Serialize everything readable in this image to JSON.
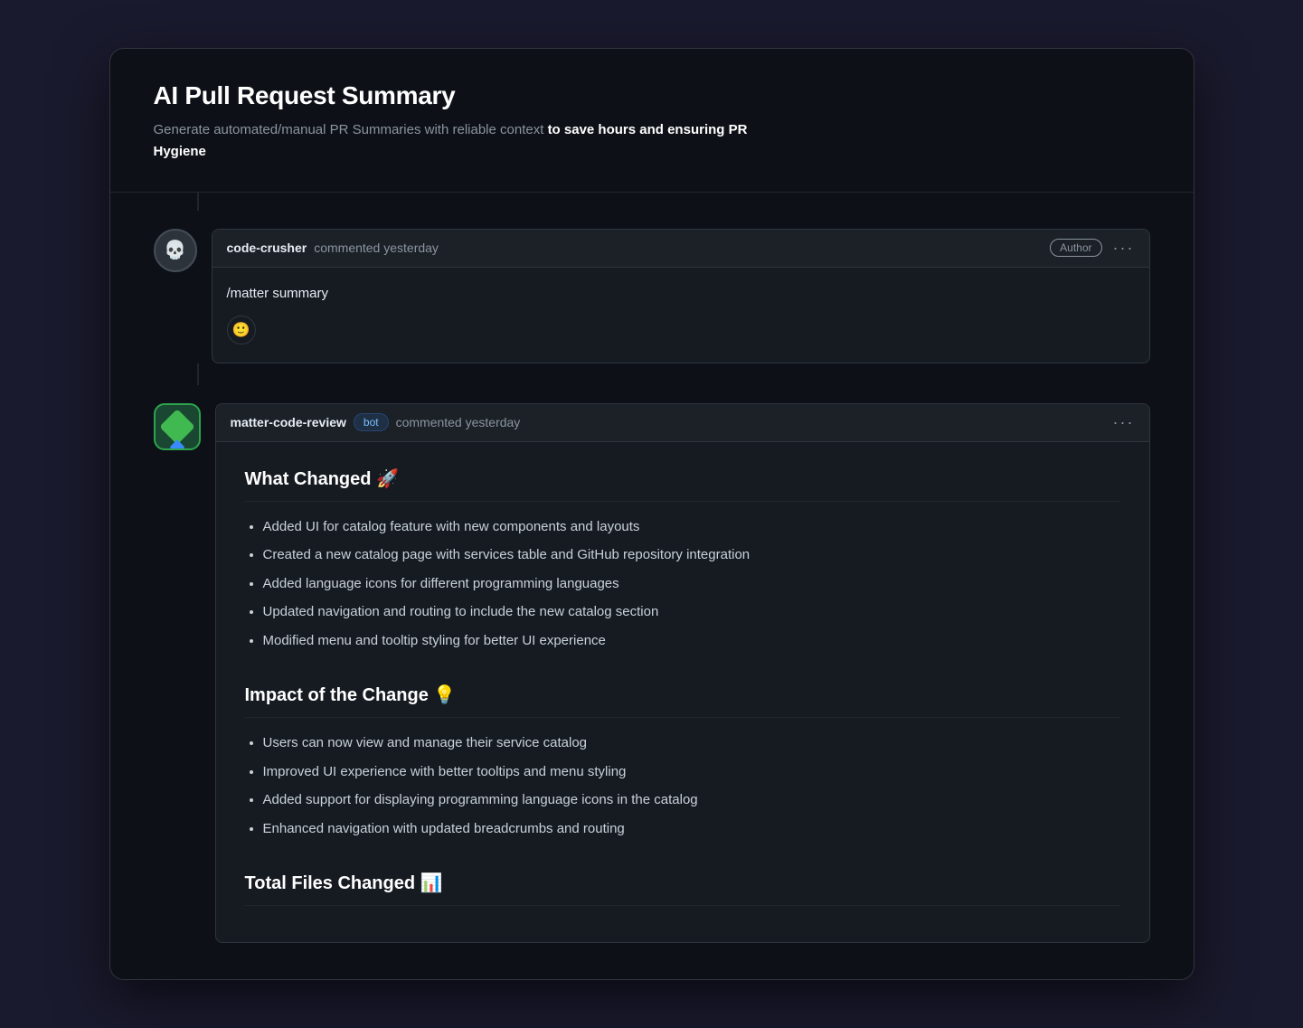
{
  "app": {
    "title": "AI Pull Request Summary",
    "subtitle_start": "Generate automated/manual PR Summaries with reliable context ",
    "subtitle_bold": "to save hours and ensuring PR Hygiene"
  },
  "comments": [
    {
      "id": "comment-1",
      "avatar_type": "human",
      "avatar_emoji": "💀",
      "author": "code-crusher",
      "time_text": "commented yesterday",
      "badges": [
        "Author"
      ],
      "has_dots": true,
      "body_text": "/matter summary",
      "has_emoji_reaction": true
    },
    {
      "id": "comment-2",
      "avatar_type": "bot",
      "author": "matter-code-review",
      "bot_badge": "bot",
      "time_text": "commented yesterday",
      "has_dots": true,
      "sections": [
        {
          "title": "What Changed 🚀",
          "items": [
            "Added UI for catalog feature with new components and layouts",
            "Created a new catalog page with services table and GitHub repository integration",
            "Added language icons for different programming languages",
            "Updated navigation and routing to include the new catalog section",
            "Modified menu and tooltip styling for better UI experience"
          ]
        },
        {
          "title": "Impact of the Change 💡",
          "items": [
            "Users can now view and manage their service catalog",
            "Improved UI experience with better tooltips and menu styling",
            "Added support for displaying programming language icons in the catalog",
            "Enhanced navigation with updated breadcrumbs and routing"
          ]
        },
        {
          "title": "Total Files Changed 📊",
          "items": []
        }
      ]
    }
  ],
  "labels": {
    "author_badge": "Author",
    "bot_badge": "bot",
    "dots": "···"
  }
}
